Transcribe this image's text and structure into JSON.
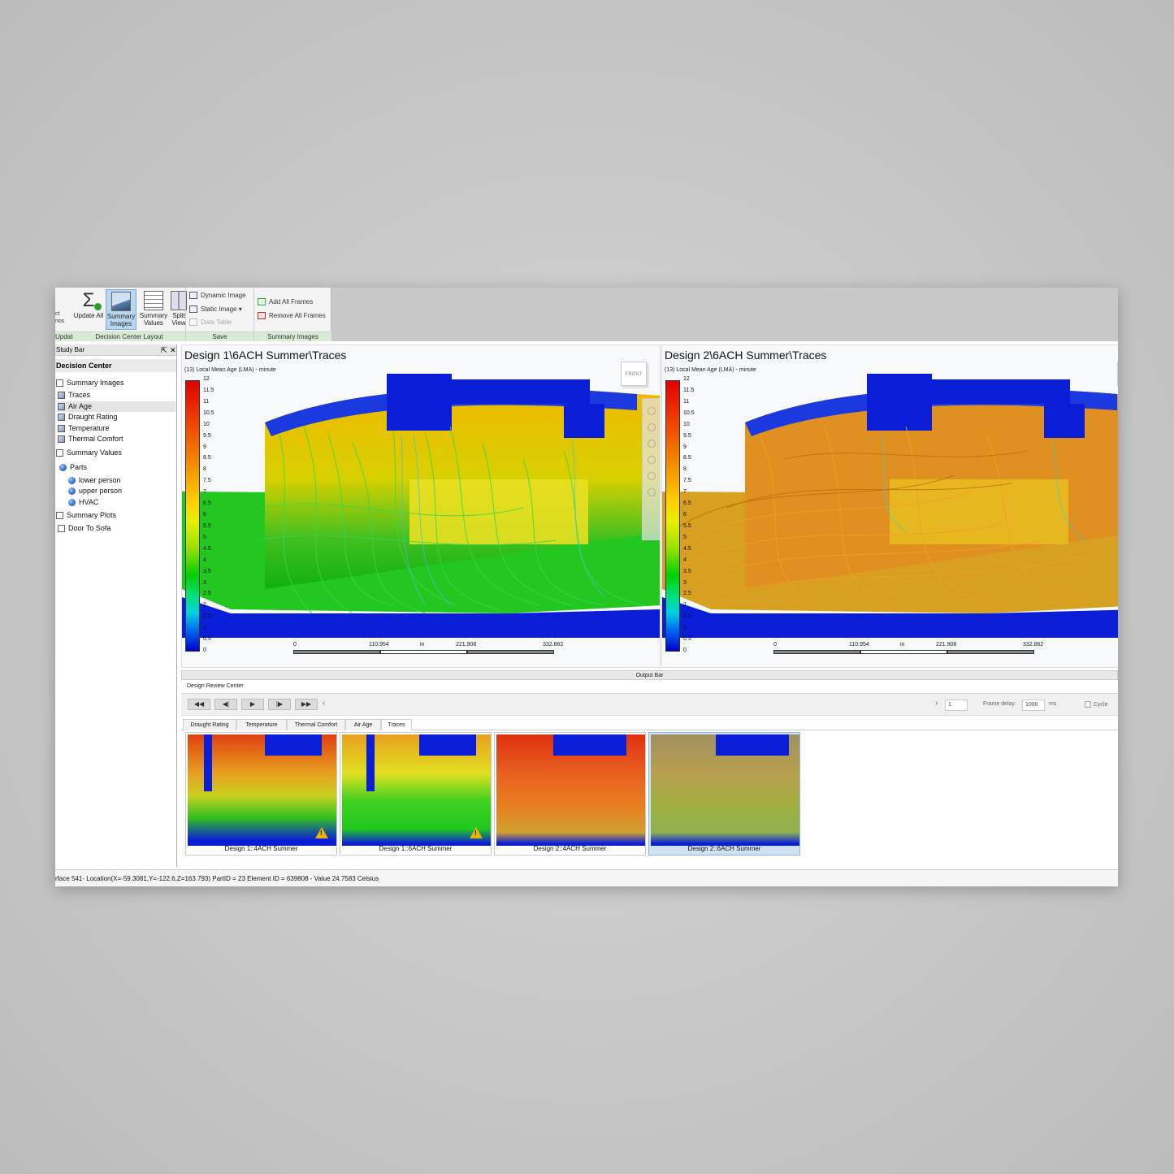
{
  "ribbon": {
    "cut_btn": "ct\nrios",
    "update_all": "Update All",
    "summary_images": "Summary Images",
    "summary_values": "Summary Values",
    "split_view": "Split View",
    "dynamic_image": "Dynamic Image",
    "static_image": "Static Image",
    "data_table": "Data Table",
    "add_all_frames": "Add All Frames",
    "remove_all_frames": "Remove All Frames",
    "group_update": "Update",
    "group_layout": "Decision Center Layout",
    "group_save": "Save",
    "group_summary": "Summary Images"
  },
  "studybar": {
    "header": "Study Bar",
    "pin": "⇱",
    "close": "✕",
    "title": "Decision Center",
    "items": [
      {
        "label": "Summary Images"
      },
      {
        "label": "Traces"
      },
      {
        "label": "Air Age"
      },
      {
        "label": "Draught Rating"
      },
      {
        "label": "Temperature"
      },
      {
        "label": "Thermal Comfort"
      },
      {
        "label": "Summary Values"
      },
      {
        "label": "Parts"
      },
      {
        "label": "lower person"
      },
      {
        "label": "upper person"
      },
      {
        "label": "HVAC"
      },
      {
        "label": "Summary Plots"
      },
      {
        "label": "Door To Sofa"
      }
    ]
  },
  "views": [
    {
      "title": "Design 1\\6ACH Summer\\Traces",
      "subtitle": "(13) Local Mean Age (LMA) - minute",
      "scale": [
        "0",
        "110.954",
        "in",
        "221.908",
        "332.862"
      ]
    },
    {
      "title": "Design 2\\6ACH Summer\\Traces",
      "subtitle": "(13) Local Mean Age (LMA) - minute",
      "scale": [
        "0",
        "110.954",
        "in",
        "221.908",
        "332.862"
      ]
    }
  ],
  "legend_ticks": [
    "12",
    "11.5",
    "11",
    "10.5",
    "10",
    "9.5",
    "9",
    "8.5",
    "8",
    "7.5",
    "7",
    "6.5",
    "6",
    "5.5",
    "5",
    "4.5",
    "4",
    "3.5",
    "3",
    "2.5",
    "2",
    "1.5",
    "1",
    "0.5",
    "0"
  ],
  "navcube_label": "FRONT",
  "output_bar": "Output Bar",
  "drc": {
    "title": "Design Review Center",
    "buttons": [
      "◀◀",
      "◀|",
      "▶",
      "|▶",
      "▶▶"
    ],
    "prev_arrow": "‹",
    "next_arrow": "›",
    "frame_value": "1",
    "frame_delay_label": "Frame delay:",
    "frame_delay_value": "1000",
    "ms_label": "ms",
    "cycle_label": "Cycle",
    "tabs": [
      "Draught Rating",
      "Temperature",
      "Thermal Comfort",
      "Air Age",
      "Traces"
    ],
    "thumbs": [
      {
        "caption": "Design 1::4ACH Summer",
        "warning": true
      },
      {
        "caption": "Design 1::6ACH Summer",
        "warning": true
      },
      {
        "caption": "Design 2::4ACH Summer",
        "warning": false
      },
      {
        "caption": "Design 2::6ACH Summer",
        "warning": false
      }
    ]
  },
  "status": "rface 541- Location(X=-59.3081,Y=-122.6,Z=163.793) PartID = 23 Element ID = 639808 - Value 24.7583  Celsius",
  "colors": {
    "ribbon_group_band": "#d9ead7",
    "selected_blue": "#b9d6f0",
    "geometry_blue": "#0a1ed8"
  }
}
